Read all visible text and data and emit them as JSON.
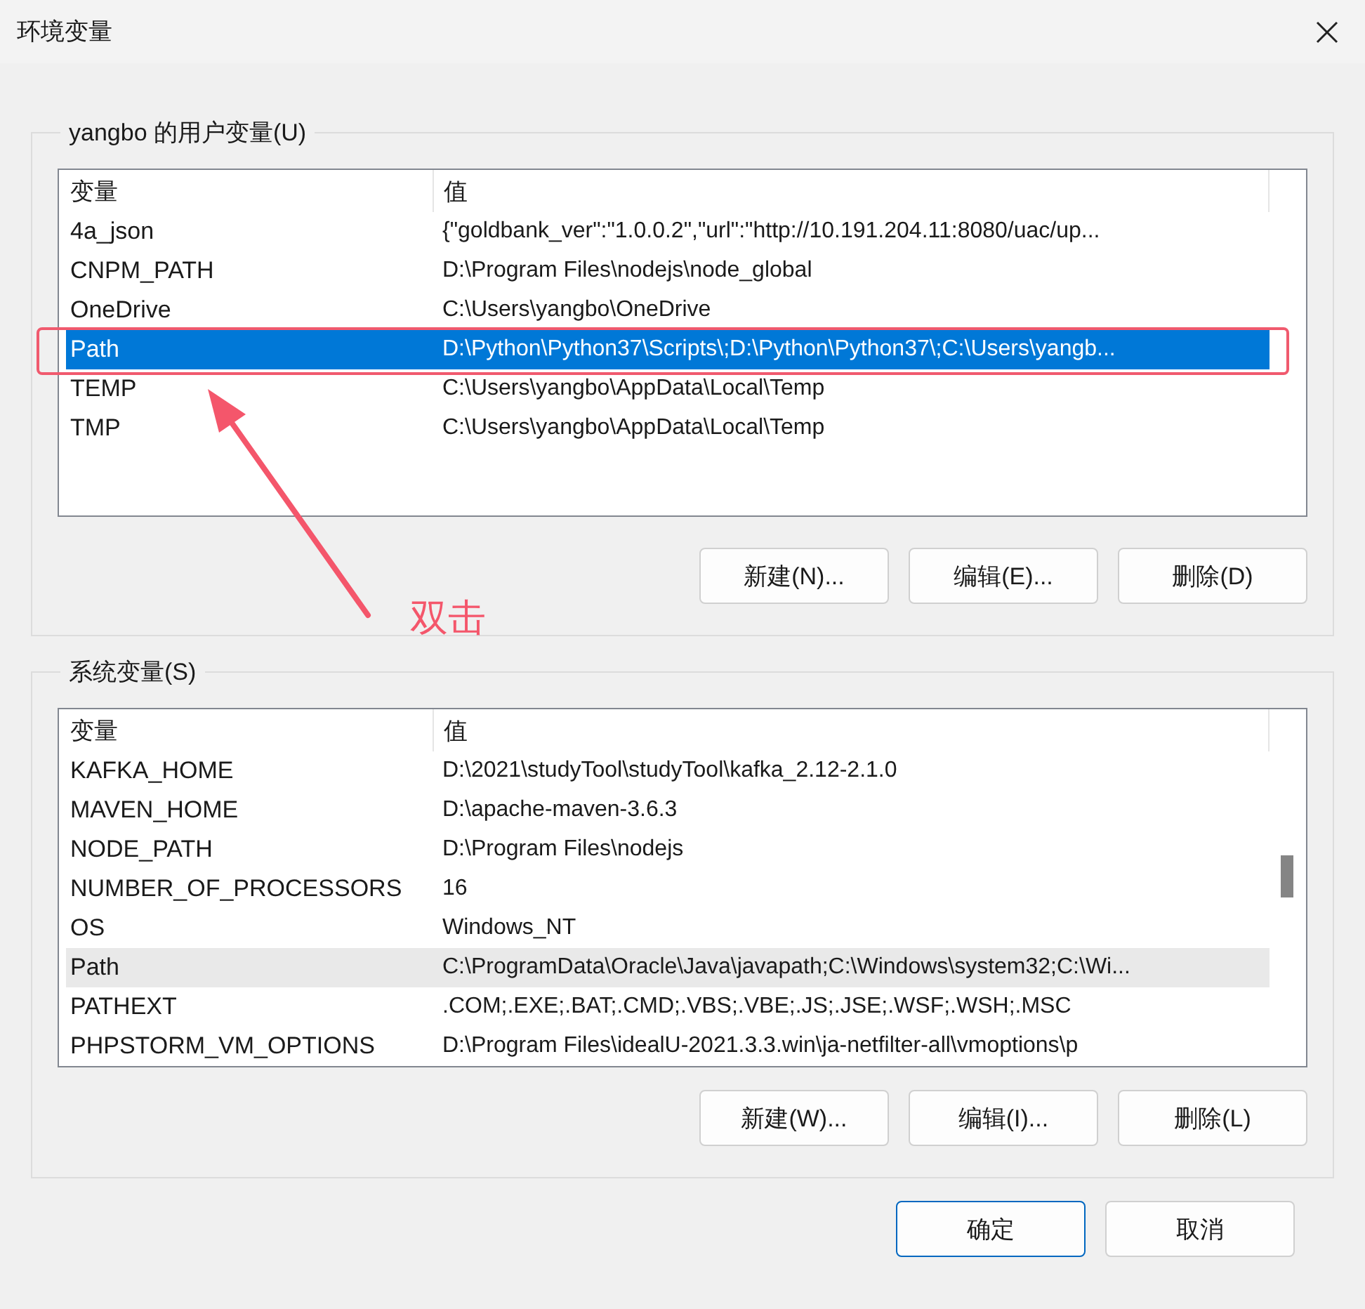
{
  "window": {
    "title": "环境变量"
  },
  "user_variables": {
    "label": "yangbo 的用户变量(U)",
    "focused": true,
    "columns": [
      "变量",
      "值"
    ],
    "rows": [
      {
        "name": "4a_json",
        "value": "{\"goldbank_ver\":\"1.0.0.2\",\"url\":\"http://10.191.204.11:8080/uac/up...",
        "selected": false
      },
      {
        "name": "CNPM_PATH",
        "value": "D:\\Program Files\\nodejs\\node_global",
        "selected": false
      },
      {
        "name": "OneDrive",
        "value": "C:\\Users\\yangbo\\OneDrive",
        "selected": false
      },
      {
        "name": "Path",
        "value": "D:\\Python\\Python37\\Scripts\\;D:\\Python\\Python37\\;C:\\Users\\yangb...",
        "selected": true
      },
      {
        "name": "TEMP",
        "value": "C:\\Users\\yangbo\\AppData\\Local\\Temp",
        "selected": false
      },
      {
        "name": "TMP",
        "value": "C:\\Users\\yangbo\\AppData\\Local\\Temp",
        "selected": false
      }
    ],
    "buttons": [
      "新建(N)...",
      "编辑(E)...",
      "删除(D)"
    ]
  },
  "annotation": {
    "label": "双击"
  },
  "system_variables": {
    "label": "系统变量(S)",
    "focused": false,
    "columns": [
      "变量",
      "值"
    ],
    "rows": [
      {
        "name": "KAFKA_HOME",
        "value": "D:\\2021\\studyTool\\studyTool\\kafka_2.12-2.1.0",
        "selected": false
      },
      {
        "name": "MAVEN_HOME",
        "value": "D:\\apache-maven-3.6.3",
        "selected": false
      },
      {
        "name": "NODE_PATH",
        "value": "D:\\Program Files\\nodejs",
        "selected": false
      },
      {
        "name": "NUMBER_OF_PROCESSORS",
        "value": "16",
        "selected": false
      },
      {
        "name": "OS",
        "value": "Windows_NT",
        "selected": false
      },
      {
        "name": "Path",
        "value": "C:\\ProgramData\\Oracle\\Java\\javapath;C:\\Windows\\system32;C:\\Wi...",
        "selected": true
      },
      {
        "name": "PATHEXT",
        "value": ".COM;.EXE;.BAT;.CMD;.VBS;.VBE;.JS;.JSE;.WSF;.WSH;.MSC",
        "selected": false
      },
      {
        "name": "PHPSTORM_VM_OPTIONS",
        "value": "D:\\Program Files\\idealU-2021.3.3.win\\ja-netfilter-all\\vmoptions\\p",
        "selected": false
      }
    ],
    "buttons": [
      "新建(W)...",
      "编辑(I)...",
      "删除(L)"
    ]
  },
  "dialog_buttons": [
    {
      "label": "确定",
      "default": true
    },
    {
      "label": "取消",
      "default": false
    }
  ]
}
